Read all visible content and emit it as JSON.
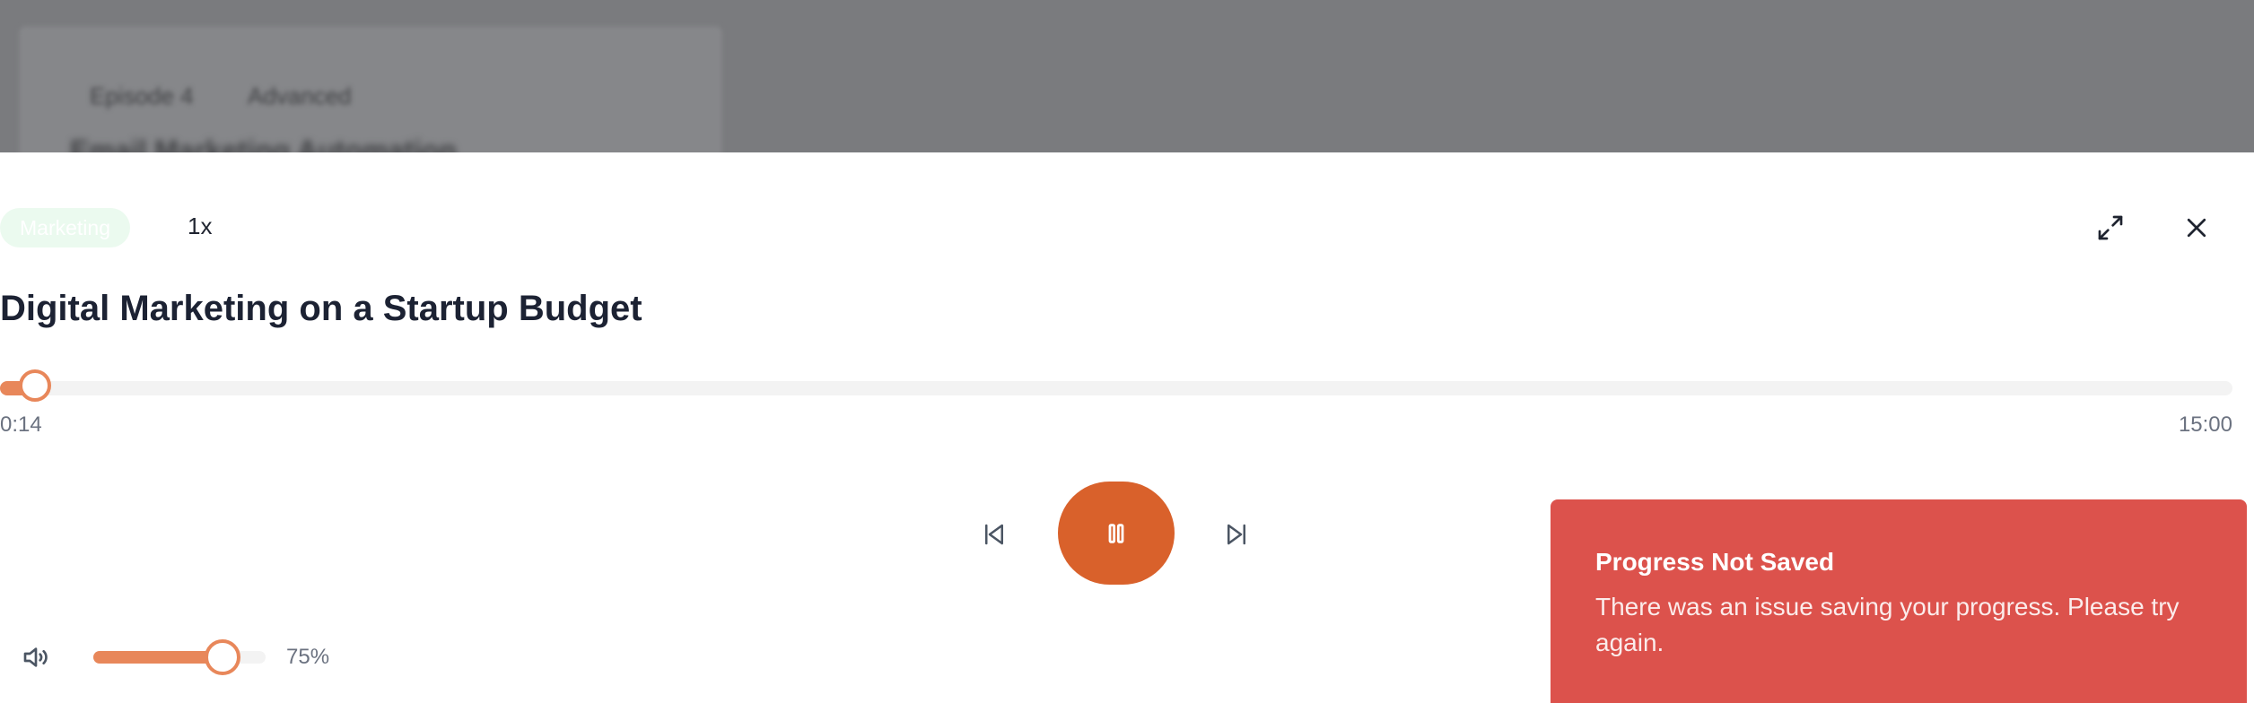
{
  "background": {
    "tags": [
      "Episode 4",
      "Advanced"
    ],
    "title": "Email Marketing Automation"
  },
  "player": {
    "category_badge": "Marketing",
    "speed": "1x",
    "title": "Digital Marketing on a Startup Budget",
    "progress": {
      "current_time": "0:14",
      "total_time": "15:00",
      "fraction": 0.0156
    },
    "volume": {
      "percent": 75,
      "label": "75%"
    },
    "icons": {
      "expand": "expand-icon",
      "close": "close-icon",
      "skip_back": "skip-back-icon",
      "play_pause": "pause-icon",
      "skip_forward": "skip-forward-icon",
      "volume": "volume-icon"
    }
  },
  "toast": {
    "title": "Progress Not Saved",
    "message": "There was an issue saving your progress. Please try again."
  },
  "colors": {
    "accent": "#d9612b",
    "accent_light": "#e8875a",
    "toast_error": "#dc524c",
    "badge_bg": "#ebfaef",
    "overlay": "#7a7b7e"
  }
}
